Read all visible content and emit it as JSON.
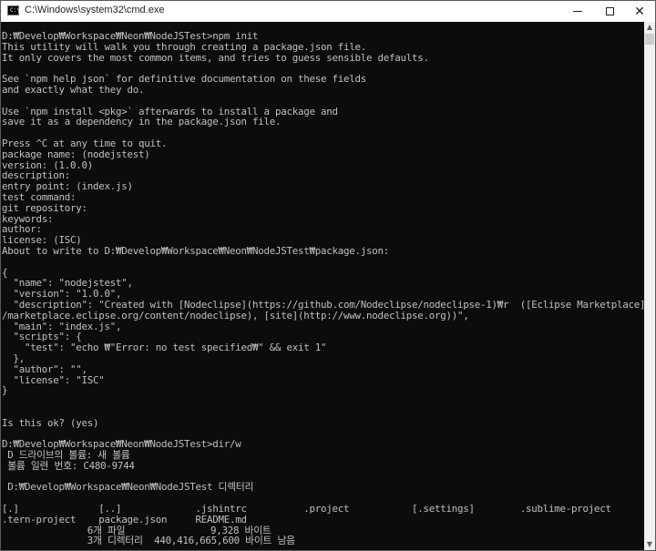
{
  "window": {
    "title": "C:\\Windows\\system32\\cmd.exe",
    "icon_label": "C:\\",
    "controls": {
      "minimize": "minimize",
      "maximize": "maximize",
      "close": "✕"
    }
  },
  "colors": {
    "console_background": "#0c0c0c",
    "console_text": "#c0c0c0",
    "titlebar": "#ffffff"
  },
  "console": {
    "lines": [
      "D:₩Develop₩Workspace₩Neon₩NodeJSTest>npm init",
      "This utility will walk you through creating a package.json file.",
      "It only covers the most common items, and tries to guess sensible defaults.",
      "",
      "See `npm help json` for definitive documentation on these fields",
      "and exactly what they do.",
      "",
      "Use `npm install <pkg>` afterwards to install a package and",
      "save it as a dependency in the package.json file.",
      "",
      "Press ^C at any time to quit.",
      "package name: (nodejstest)",
      "version: (1.0.0)",
      "description:",
      "entry point: (index.js)",
      "test command:",
      "git repository:",
      "keywords:",
      "author:",
      "license: (ISC)",
      "About to write to D:₩Develop₩Workspace₩Neon₩NodeJSTest₩package.json:",
      "",
      "{",
      "  \"name\": \"nodejstest\",",
      "  \"version\": \"1.0.0\",",
      "  \"description\": \"Created with [Nodeclipse](https://github.com/Nodeclipse/nodeclipse-1)₩r  ([Eclipse Marketplace](http:/",
      "/marketplace.eclipse.org/content/nodeclipse), [site](http://www.nodeclipse.org))\",",
      "  \"main\": \"index.js\",",
      "  \"scripts\": {",
      "    \"test\": \"echo ₩\"Error: no test specified₩\" && exit 1\"",
      "  },",
      "  \"author\": \"\",",
      "  \"license\": \"ISC\"",
      "}",
      "",
      "",
      "Is this ok? (yes)",
      "",
      "D:₩Develop₩Workspace₩Neon₩NodeJSTest>dir/w",
      " D 드라이브의 볼륨: 새 볼륨",
      " 볼륨 일련 번호: C480-9744",
      "",
      " D:₩Develop₩Workspace₩Neon₩NodeJSTest 디렉터리",
      "",
      "[.]              [..]             .jshintrc          .project           [.settings]        .sublime-project",
      ".tern-project    package.json     README.md",
      "               6개 파일               9,328 바이트",
      "               3개 디렉터리  440,416,665,600 바이트 남음"
    ]
  }
}
